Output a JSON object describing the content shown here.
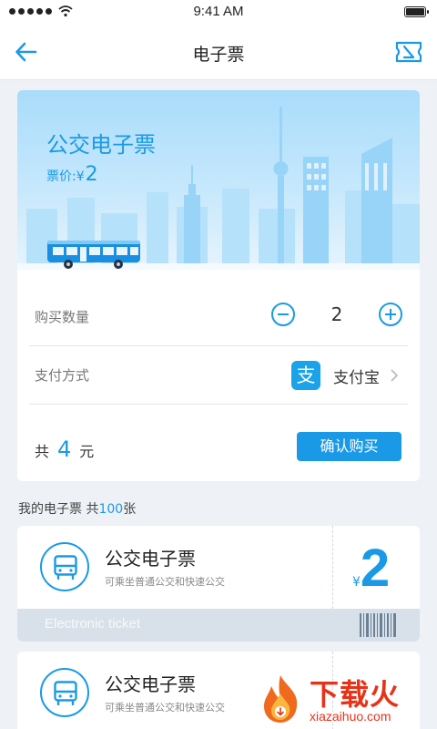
{
  "status_bar": {
    "time": "9:41 AM",
    "signal_icon": "signal-dots-icon",
    "wifi_icon": "wifi-icon",
    "battery_icon": "battery-icon"
  },
  "nav": {
    "title": "电子票",
    "back_icon": "arrow-left-icon",
    "ticket_icon": "ticket-icon"
  },
  "hero": {
    "title": "公交电子票",
    "price_label": "票价:",
    "currency": "¥",
    "price": "2"
  },
  "purchase": {
    "quantity_label": "购买数量",
    "quantity": "2",
    "payment_label": "支付方式",
    "payment_logo": "支",
    "payment_method": "支付宝",
    "total_prefix": "共",
    "total": "4",
    "total_unit": "元",
    "confirm_label": "确认购买"
  },
  "my_tickets": {
    "heading": "我的电子票 共",
    "count": "100",
    "unit": "张"
  },
  "tickets": [
    {
      "title": "公交电子票",
      "subtitle": "可乘坐普通公交和快速公交",
      "currency": "¥",
      "price": "2",
      "footer": "Electronic ticket"
    },
    {
      "title": "公交电子票",
      "subtitle": "可乘坐普通公交和快速公交"
    }
  ],
  "watermark": {
    "text": "下载火",
    "url": "xiazaihuo.com"
  },
  "colors": {
    "accent": "#1a9ae6",
    "hero_sky": "#a9dcfb",
    "footer_band": "#d8e1e9",
    "watermark": "#e83218"
  }
}
